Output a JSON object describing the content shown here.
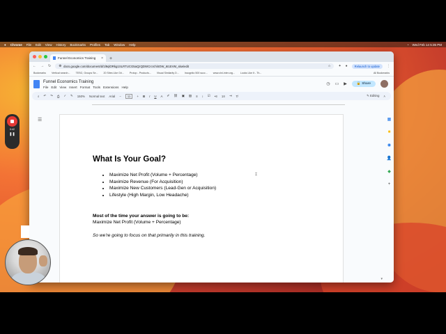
{
  "menubar": {
    "app": "Chrome",
    "items": [
      "File",
      "Edit",
      "View",
      "History",
      "Bookmarks",
      "Profiles",
      "Tab",
      "Window",
      "Help"
    ],
    "datetime": "Wed Feb 14  5:35 PM"
  },
  "browser": {
    "tab_title": "Funnel Economics Training",
    "url": "docs.google.com/document/d/1l9qlORkg1SLRTUCG5aQzQDWCrcrchl4OW_6I1EVM_skw/edit",
    "relaunch_label": "Relaunch to update",
    "bookmarks": [
      "Bookmarks",
      "Vertical search...",
      "TESG, Groups Se...",
      "20 Sites Like Gri...",
      "Protop - Products...",
      "Visual Similarity D...",
      "Incognito 500 succ...",
      "www.clnl-inter.org...",
      "Looks Like It - Th..."
    ],
    "all_bookmarks": "All Bookmarks"
  },
  "doc": {
    "title": "Funnel Economics Training",
    "menus": [
      "File",
      "Edit",
      "View",
      "Insert",
      "Format",
      "Tools",
      "Extensions",
      "Help"
    ],
    "share_label": "Share",
    "toolbar": {
      "zoom": "150%",
      "style": "Normal text",
      "font": "Arial",
      "size": "11",
      "mode": "Editing"
    },
    "heading": "What Is Your Goal?",
    "goals": [
      "Maximize Net Profit (Volume + Percentage)",
      "Maximize Revenue (For Acquisition)",
      "Maximize New Customers (Lead-Gen or Acquisition)",
      "Lifestyle (High Margin, Low Headache)"
    ],
    "bold_line": "Most of the time your answer is going to be:",
    "answer": "Maximize Net Profit (Volume + Percentage)",
    "italic_line": "So we're going to focus on that primarily in this training."
  },
  "recorder": {
    "time": "0:42"
  },
  "colors": {
    "accent": "#0b57d0",
    "share_bg": "#c2e7ff",
    "record": "#e53935"
  }
}
